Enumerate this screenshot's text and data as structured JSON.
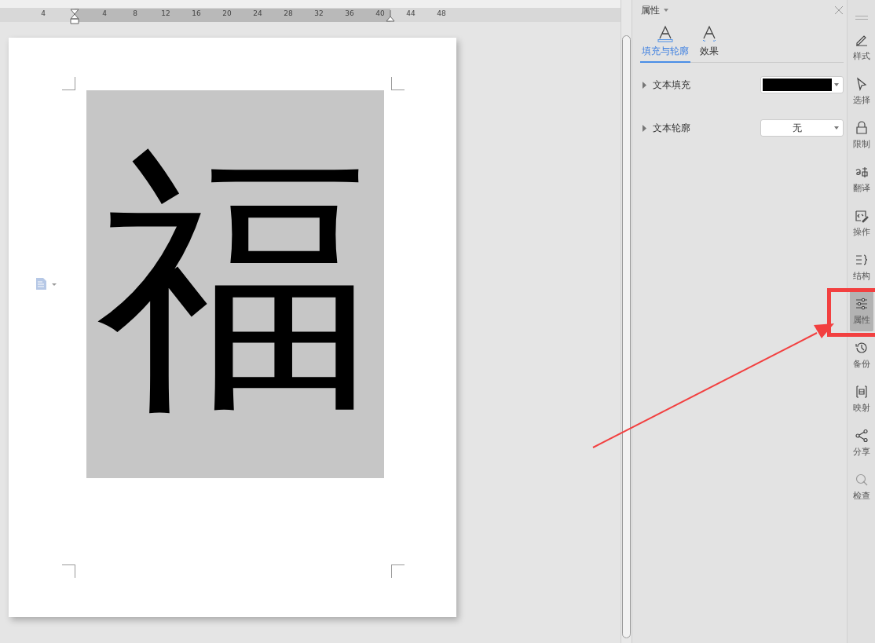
{
  "ruler": {
    "labels": [
      "4",
      "4",
      "8",
      "12",
      "16",
      "20",
      "24",
      "28",
      "32",
      "36",
      "40",
      "44",
      "48"
    ]
  },
  "document": {
    "character": "福"
  },
  "panel": {
    "title": "属性",
    "tabs": [
      {
        "label": "填充与轮廓",
        "selected": true
      },
      {
        "label": "效果",
        "selected": false
      }
    ],
    "rows": [
      {
        "label": "文本填充",
        "kind": "swatch",
        "color": "#000000"
      },
      {
        "label": "文本轮廓",
        "kind": "value",
        "value": "无"
      }
    ]
  },
  "toolbar": [
    {
      "label": "样式",
      "selected": false
    },
    {
      "label": "选择",
      "selected": false
    },
    {
      "label": "限制",
      "selected": false
    },
    {
      "label": "翻译",
      "selected": false
    },
    {
      "label": "操作",
      "selected": false
    },
    {
      "label": "结构",
      "selected": false
    },
    {
      "label": "属性",
      "selected": true
    },
    {
      "label": "备份",
      "selected": false
    },
    {
      "label": "映射",
      "selected": false
    },
    {
      "label": "分享",
      "selected": false
    },
    {
      "label": "检查",
      "selected": false
    }
  ]
}
